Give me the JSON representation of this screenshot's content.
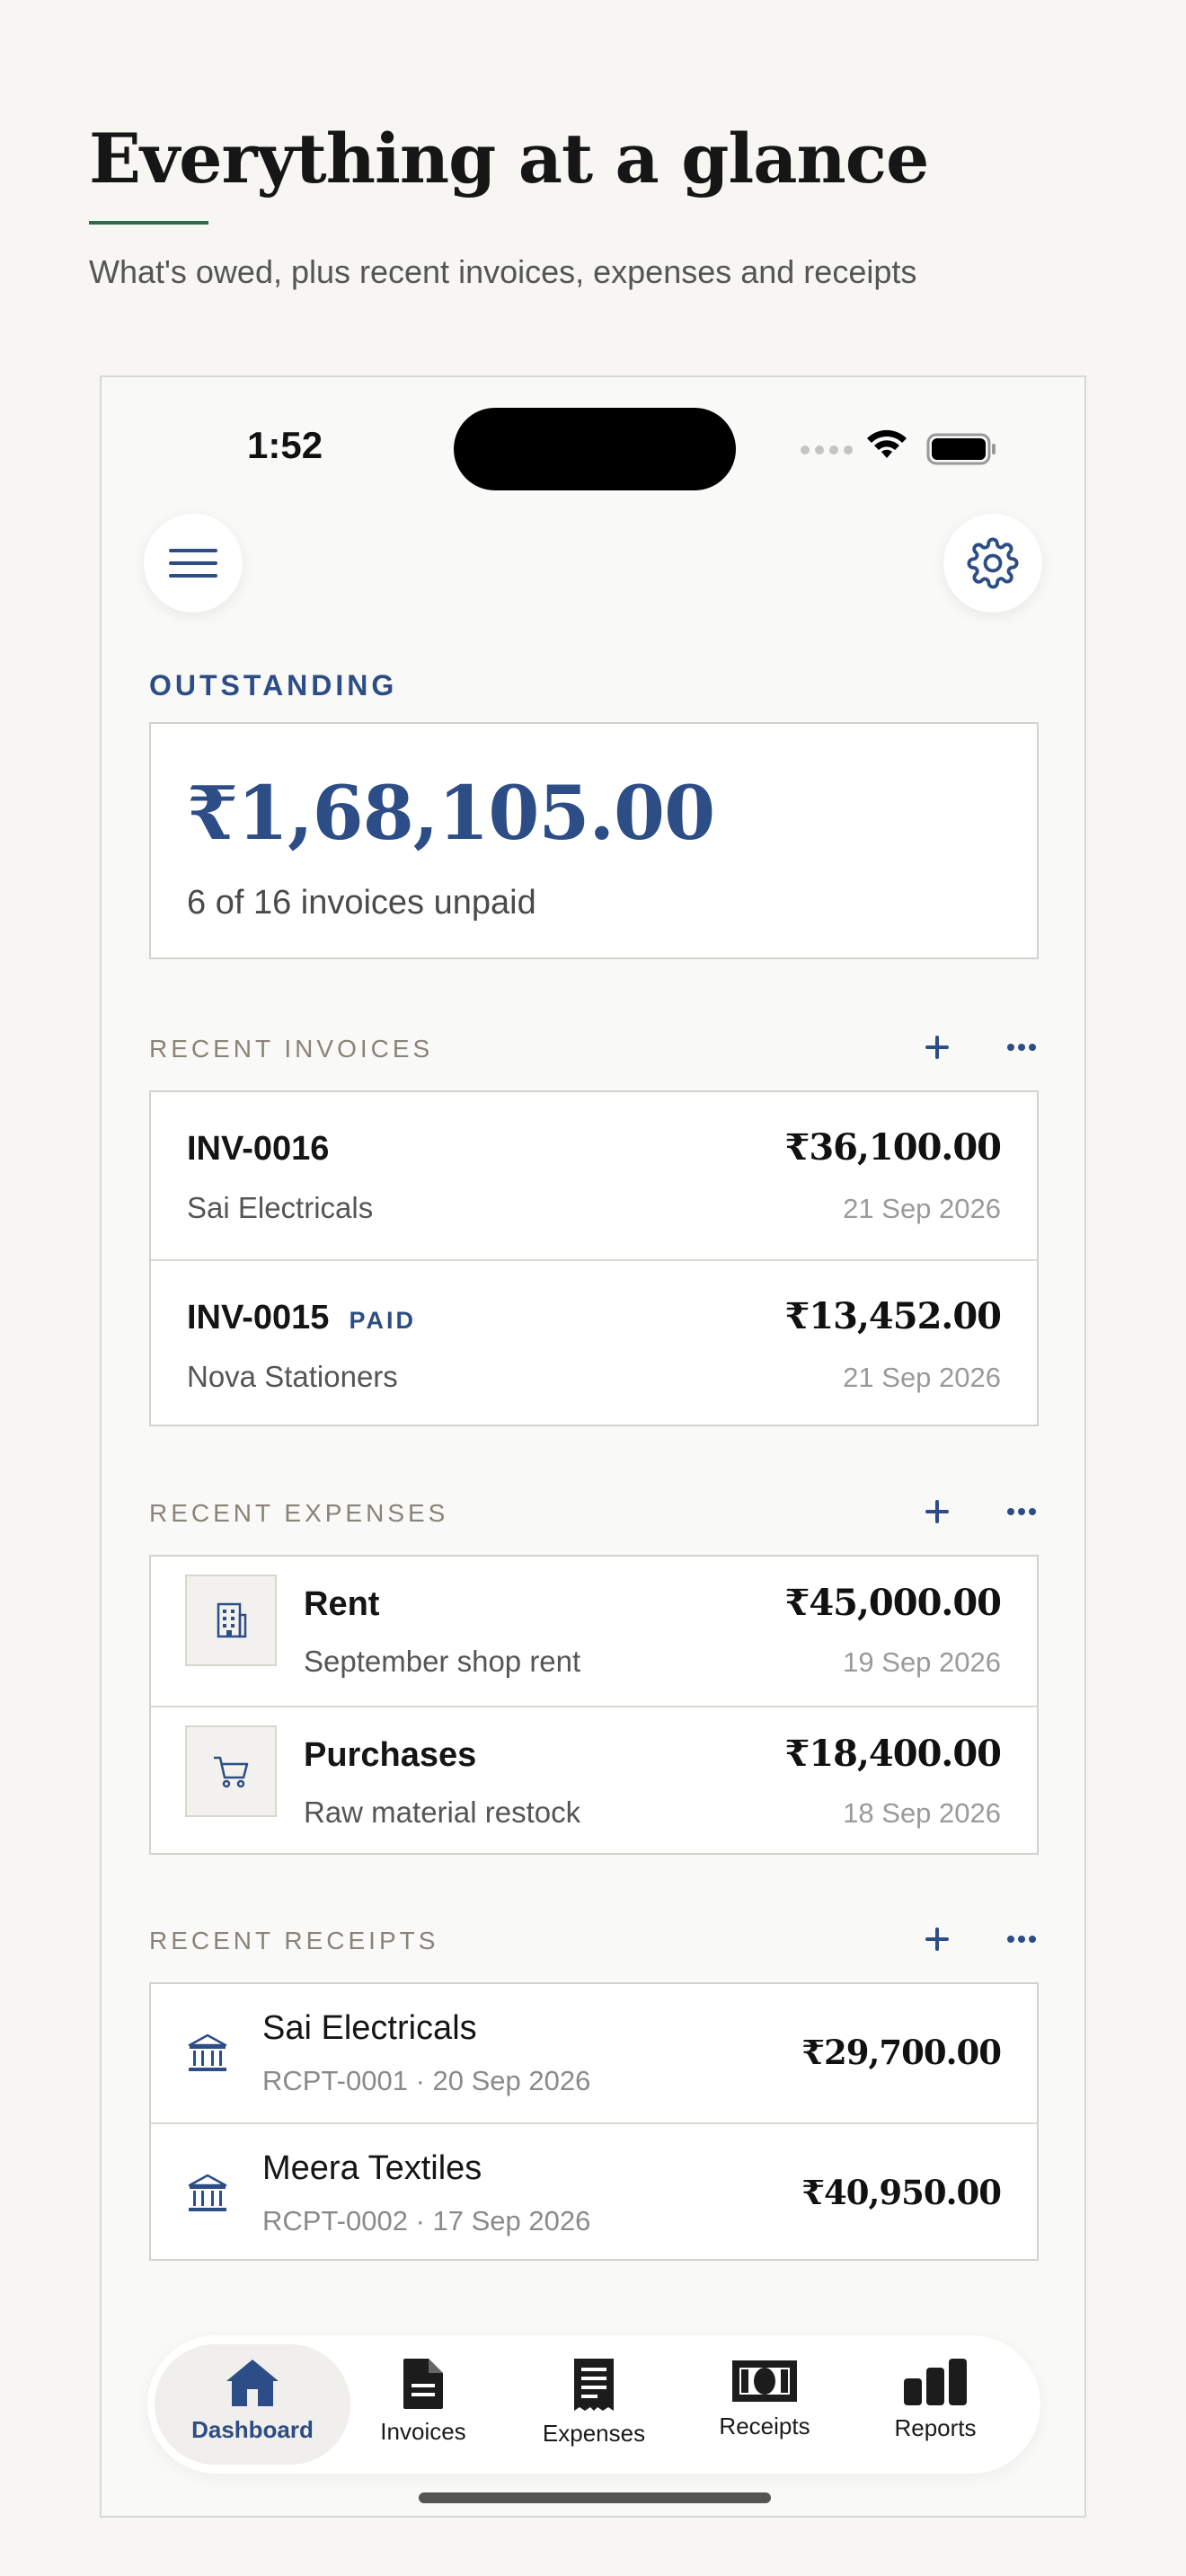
{
  "header": {
    "title": "Everything at a glance",
    "subtitle": "What's owed, plus recent invoices, expenses and receipts"
  },
  "status_bar": {
    "time": "1:52"
  },
  "outstanding": {
    "label": "OUTSTANDING",
    "amount": "₹1,68,105.00",
    "note": "6 of 16 invoices unpaid"
  },
  "invoices": {
    "label": "RECENT INVOICES",
    "items": [
      {
        "number": "INV-0016",
        "client": "Sai Electricals",
        "amount": "₹36,100.00",
        "date": "21 Sep 2026",
        "badge": ""
      },
      {
        "number": "INV-0015",
        "client": "Nova Stationers",
        "amount": "₹13,452.00",
        "date": "21 Sep 2026",
        "badge": "PAID"
      }
    ]
  },
  "expenses": {
    "label": "RECENT EXPENSES",
    "items": [
      {
        "category": "Rent",
        "description": "September shop rent",
        "amount": "₹45,000.00",
        "date": "19 Sep 2026",
        "icon": "building-icon"
      },
      {
        "category": "Purchases",
        "description": "Raw material restock",
        "amount": "₹18,400.00",
        "date": "18 Sep 2026",
        "icon": "cart-icon"
      }
    ]
  },
  "receipts": {
    "label": "RECENT RECEIPTS",
    "items": [
      {
        "payer": "Sai Electricals",
        "meta": "RCPT-0001 · 20 Sep 2026",
        "amount": "₹29,700.00",
        "icon": "bank-icon"
      },
      {
        "payer": "Meera Textiles",
        "meta": "RCPT-0002 · 17 Sep 2026",
        "amount": "₹40,950.00",
        "icon": "bank-icon"
      }
    ]
  },
  "tabbar": {
    "active": "Dashboard",
    "tabs": [
      {
        "label": "Dashboard",
        "icon": "home-icon"
      },
      {
        "label": "Invoices",
        "icon": "document-icon"
      },
      {
        "label": "Expenses",
        "icon": "receipt-list-icon"
      },
      {
        "label": "Receipts",
        "icon": "banknote-icon"
      },
      {
        "label": "Reports",
        "icon": "bar-chart-icon"
      }
    ]
  },
  "colors": {
    "accent": "#2d4d86",
    "title_rule": "#2e6b4a",
    "background": "#f7f6f3"
  }
}
